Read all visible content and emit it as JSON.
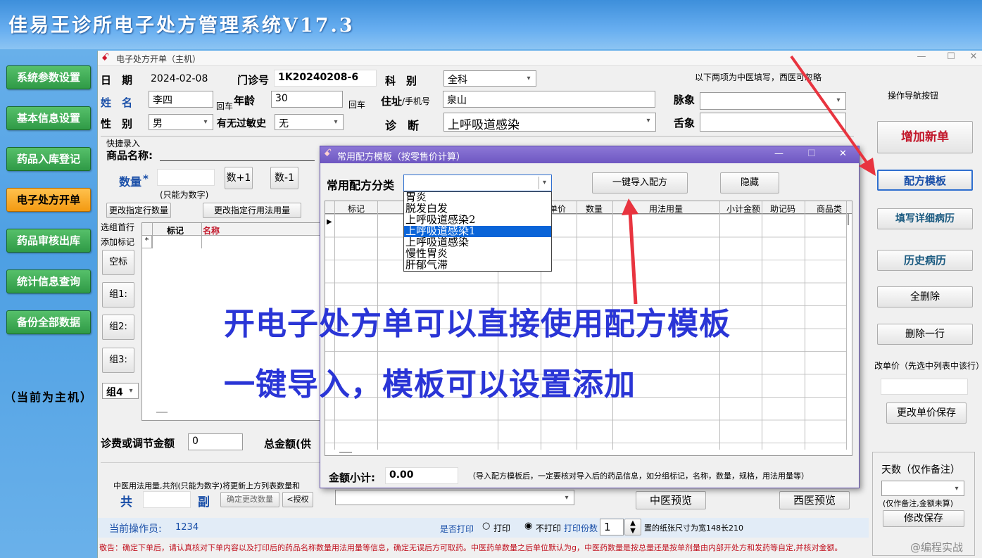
{
  "app": {
    "title": "佳易王诊所电子处方管理系统V17.3"
  },
  "nav": {
    "items": [
      {
        "label": "系统参数设置",
        "active": false
      },
      {
        "label": "基本信息设置",
        "active": false
      },
      {
        "label": "药品入库登记",
        "active": false
      },
      {
        "label": "电子处方开单",
        "active": true
      },
      {
        "label": "药品审核出库",
        "active": false
      },
      {
        "label": "统计信息查询",
        "active": false
      },
      {
        "label": "备份全部数据",
        "active": false
      }
    ],
    "host_label": "（当前为主机）"
  },
  "form": {
    "window_title": "电子处方开单（主机）",
    "date_label": "日　期",
    "date_value": "2024-02-08",
    "clinic_no_label": "门诊号",
    "clinic_no_value": "1K20240208-6",
    "dept_label": "科　别",
    "dept_value": "全科",
    "tcm_note": "以下两项为中医填写，西医可忽略",
    "name_label": "姓　名",
    "name_value": "李四",
    "enter_hint": "回车",
    "age_label": "年龄",
    "age_value": "30",
    "address_label": "住址",
    "phone_label": "/手机号",
    "address_value": "泉山",
    "pulse_label": "脉象",
    "gender_label": "性　别",
    "gender_value": "男",
    "allergy_label": "有无过敏史",
    "allergy_value": "无",
    "diagnosis_label": "诊　断",
    "diagnosis_value": "上呼吸道感染",
    "tongue_label": "舌象",
    "quick_entry_label": "快捷录入",
    "product_name_label": "商品名称:",
    "qty_label": "数量",
    "qty_star": "*",
    "qty_plus": "数+1",
    "qty_minus": "数-1",
    "qty_hint": "(只能为数字)",
    "change_row_qty": "更改指定行数量",
    "change_row_usage": "更改指定行用法用量",
    "select_first_row": "选组首行",
    "add_mark": "添加标记",
    "blank_mark": "空标",
    "group1": "组1:",
    "group2": "组2:",
    "group3": "组3:",
    "group4": "组4",
    "grid_headers": [
      "标记",
      "名称"
    ],
    "fee_label": "诊费或调节金额",
    "fee_value": "0",
    "total_label": "总金额(供",
    "tcm_usage_note": "中医用法用量,共剂(只能为数字)将更新上方列表数量和",
    "total_char": "共",
    "dose_char": "副",
    "confirm_change_qty": "确定更改数量",
    "authorize": "<授权",
    "tcm_preview": "中医预览",
    "western_preview": "西医预览"
  },
  "right_panel": {
    "nav_title": "操作导航按钮",
    "add_new": "增加新单",
    "template": "配方模板",
    "fill_record": "填写详细病历",
    "history": "历史病历",
    "delete_all": "全删除",
    "delete_row": "删除一行",
    "change_price_label": "改单价（先选中列表中该行）",
    "save_price": "更改单价保存",
    "days_label": "天数（仅作备注）",
    "days_note": "(仅作备注,金额未算)",
    "modify_save": "修改保存"
  },
  "modal": {
    "title": "常用配方模板（按零售价计算）",
    "category_label": "常用配方分类",
    "category_value": "",
    "import_btn": "一键导入配方",
    "hide_btn": "隐藏",
    "dropdown_items": [
      {
        "label": "胃炎",
        "selected": false
      },
      {
        "label": "脱发白发",
        "selected": false
      },
      {
        "label": "上呼吸道感染2",
        "selected": false
      },
      {
        "label": "上呼吸道感染1",
        "selected": true
      },
      {
        "label": "上呼吸道感染",
        "selected": false
      },
      {
        "label": "慢性胃炎",
        "selected": false
      },
      {
        "label": "肝郁气滞",
        "selected": false
      }
    ],
    "grid_headers": [
      "标记",
      "单价",
      "数量",
      "用法用量",
      "小计金额",
      "助记码",
      "商品类"
    ],
    "subtotal_label": "金额小计:",
    "subtotal_value": "0.00",
    "footer_note": "（导入配方模板后，一定要核对导入后的药品信息，如分组标记，名称，数量，规格，用法用量等）"
  },
  "overlay": {
    "line1": "开电子处方单可以直接使用配方模板",
    "line2": "一键导入，模板可以设置添加"
  },
  "status": {
    "operator_label": "当前操作员:",
    "operator_value": "1234",
    "print_question": "是否打印",
    "print_option": "打印",
    "no_print_option": "不打印",
    "copies_label": "打印份数",
    "copies_value": "1",
    "paper_note": "置的纸张尺寸为宽148长210",
    "notice": "敬告：确定下单后，请认真核对下单内容以及打印后的药品名称数量用法用量等信息，确定无误后方可取药。中医药单数量之后单位默认为g，中医药数量是按总量还是按单剂量由内部开处方和发药等自定,并核对金额。",
    "watermark": "@编程实战"
  },
  "colors": {
    "accent_red": "#c2182b",
    "accent_blue": "#1a4fa8",
    "overlay_blue": "#2a35d6",
    "modal_title": "#6e57c2",
    "nav_green": "#2f9a46",
    "nav_active": "#f39a12",
    "arrow_red": "#e8343f"
  }
}
